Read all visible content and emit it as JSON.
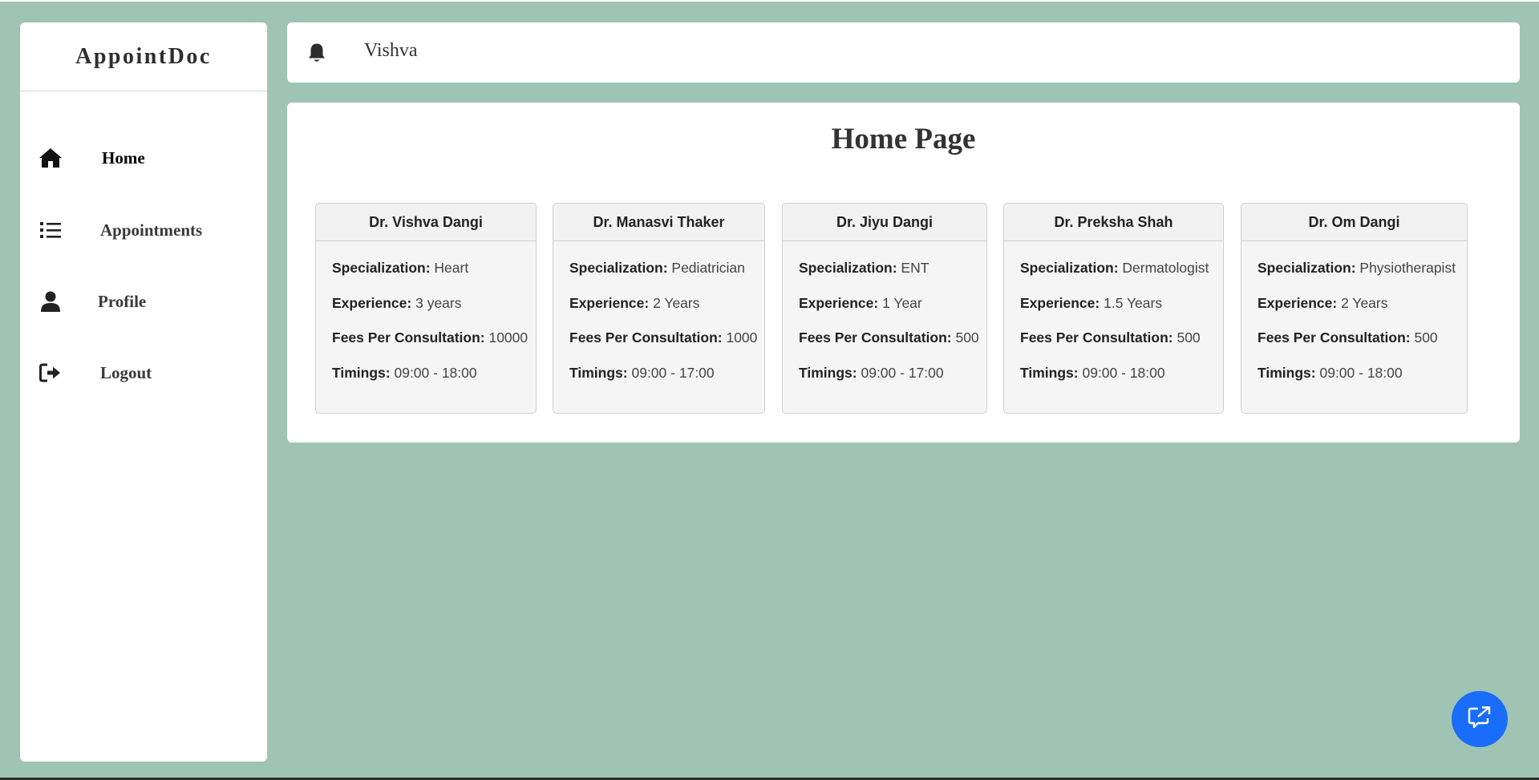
{
  "app": {
    "logo": "AppointDoc"
  },
  "sidebar": {
    "items": [
      {
        "label": "Home",
        "icon": "home-icon",
        "active": true
      },
      {
        "label": "Appointments",
        "icon": "list-icon",
        "active": false
      },
      {
        "label": "Profile",
        "icon": "user-icon",
        "active": false
      },
      {
        "label": "Logout",
        "icon": "logout-icon",
        "active": false
      }
    ]
  },
  "header": {
    "username": "Vishva",
    "icon": "bell-icon"
  },
  "main": {
    "title": "Home Page"
  },
  "field_labels": {
    "specialization": "Specialization:",
    "experience": "Experience:",
    "fees": "Fees Per Consultation:",
    "timings": "Timings:"
  },
  "doctors": [
    {
      "name": "Dr. Vishva Dangi",
      "specialization": "Heart",
      "experience": "3 years",
      "fees": "10000",
      "timings": "09:00 - 18:00"
    },
    {
      "name": "Dr. Manasvi Thaker",
      "specialization": "Pediatrician",
      "experience": "2 Years",
      "fees": "1000",
      "timings": "09:00 - 17:00"
    },
    {
      "name": "Dr. Jiyu Dangi",
      "specialization": "ENT",
      "experience": "1 Year",
      "fees": "500",
      "timings": "09:00 - 17:00"
    },
    {
      "name": "Dr. Preksha Shah",
      "specialization": "Dermatologist",
      "experience": "1.5 Years",
      "fees": "500",
      "timings": "09:00 - 18:00"
    },
    {
      "name": "Dr. Om Dangi",
      "specialization": "Physiotherapist",
      "experience": "2 Years",
      "fees": "500",
      "timings": "09:00 - 18:00"
    }
  ],
  "chat_button": {
    "icon": "chat-icon"
  },
  "colors": {
    "page_background": "#a0c4b3",
    "panel_background": "#ffffff",
    "card_background": "#f5f5f5",
    "accent": "#1a6dfa"
  }
}
